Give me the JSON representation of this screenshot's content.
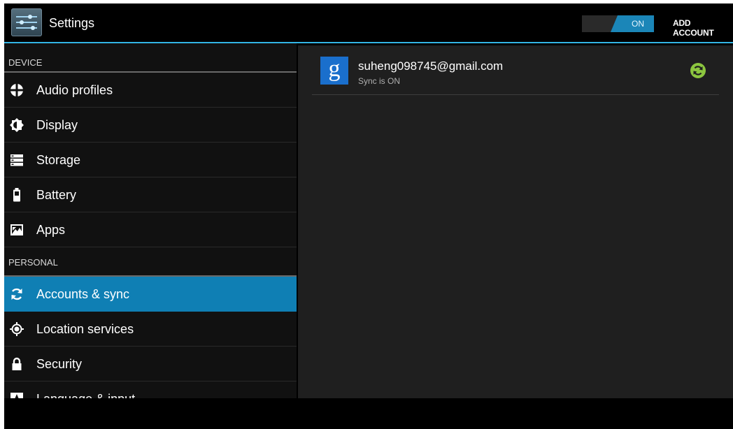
{
  "action_bar": {
    "title": "Settings",
    "toggle_label": "ON",
    "add_account_label": "ADD ACCOUNT"
  },
  "sections": {
    "device": "DEVICE",
    "personal": "PERSONAL"
  },
  "device_items": [
    {
      "label": "Audio profiles",
      "icon": "audio-profiles-icon"
    },
    {
      "label": "Display",
      "icon": "display-icon"
    },
    {
      "label": "Storage",
      "icon": "storage-icon"
    },
    {
      "label": "Battery",
      "icon": "battery-icon"
    },
    {
      "label": "Apps",
      "icon": "apps-icon"
    }
  ],
  "personal_items": [
    {
      "label": "Accounts & sync",
      "icon": "sync-icon",
      "selected": true
    },
    {
      "label": "Location services",
      "icon": "location-icon"
    },
    {
      "label": "Security",
      "icon": "lock-icon"
    },
    {
      "label": "Language & input",
      "icon": "language-icon"
    }
  ],
  "account": {
    "email": "suheng098745@gmail.com",
    "status": "Sync is ON",
    "provider_icon": "google-icon",
    "status_icon": "sync-on-icon"
  },
  "colors": {
    "accent": "#33b5e5",
    "selected": "#0f7fb4",
    "toggle_on": "#1b86b8",
    "sync_ok": "#8cc63f"
  }
}
